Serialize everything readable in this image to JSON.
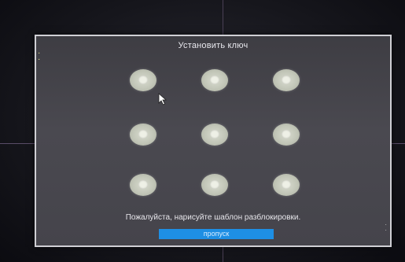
{
  "dialog": {
    "title": "Установить ключ",
    "hint": "Пожалуйста, нарисуйте шаблон разблокировки.",
    "skip_label": "пропуск"
  },
  "pattern": {
    "rows": 3,
    "cols": 3,
    "dot_icon": "pattern-dot-icon"
  },
  "icons": {
    "cursor": "mouse-pointer-icon"
  },
  "colors": {
    "accent": "#1e8fe4",
    "dialog_bg": "#45444b",
    "dot": "#c2c6b8"
  }
}
